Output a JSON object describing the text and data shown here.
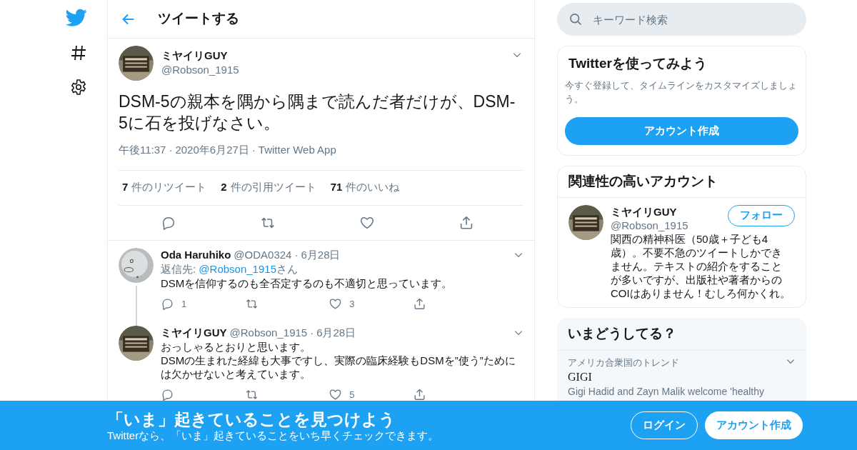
{
  "header": {
    "title": "ツイートする"
  },
  "tweet": {
    "name": "ミヤイリGUY",
    "handle": "@Robson_1915",
    "text": "DSM-5の親本を隅から隅まで読んだ者だけが、DSM-5に石を投げなさい。",
    "meta": [
      "午後11:37",
      "2020年6月27日",
      "Twitter Web App"
    ],
    "meta_separators": [
      "·",
      "·"
    ],
    "stats": [
      {
        "count": "7",
        "label": "件のリツイート"
      },
      {
        "count": "2",
        "label": "件の引用ツイート"
      },
      {
        "count": "71",
        "label": "件のいいね"
      }
    ]
  },
  "replies": [
    {
      "name": "Oda Haruhiko",
      "handle": "@ODA0324",
      "separator": "·",
      "date": "6月28日",
      "thread_line": true,
      "reply_to": {
        "prefix": "返信先: ",
        "handle": "@Robson_1915",
        "suffix": "さん"
      },
      "text": "DSMを信仰するのも全否定するのも不適切と思っています。",
      "reply_count": "1",
      "like_count": "3"
    },
    {
      "name": "ミヤイリGUY",
      "handle": "@Robson_1915",
      "separator": "·",
      "date": "6月28日",
      "thread_line": false,
      "text": "おっしゃるとおりと思います。\nDSMの生まれた経緯も大事ですし、実際の臨床経験もDSMを”使う”ためには欠かせないと考えています。",
      "like_count": "5"
    }
  ],
  "search": {
    "placeholder": "キーワード検索"
  },
  "signup_card": {
    "title": "Twitterを使ってみよう",
    "text": "今すぐ登録して、タイムラインをカスタマイズしましょう。",
    "button": "アカウント作成"
  },
  "related": {
    "title": "関連性の高いアカウント",
    "accounts": [
      {
        "name": "ミヤイリGUY",
        "handle": "@Robson_1915",
        "bio": "関西の精神科医（50歳＋子ども4歳）。不要不急のツイートしかできません。テキストの紹介をすることが多いですが、出版社や著者からのCOIはありません！むしろ何かくれ。",
        "button": "フォロー"
      }
    ]
  },
  "trends": {
    "title": "いまどうしてる？",
    "items": [
      {
        "context": "アメリカ合衆国のトレンド",
        "name": "GIGI",
        "description": "Gigi Hadid and Zayn Malik welcome 'healthy"
      }
    ]
  },
  "banner": {
    "title": "「いま」起きていることを見つけよう",
    "subtitle": "Twitterなら、「いま」起きていることをいち早くチェックできます。",
    "login": "ログイン",
    "signup": "アカウント作成"
  }
}
